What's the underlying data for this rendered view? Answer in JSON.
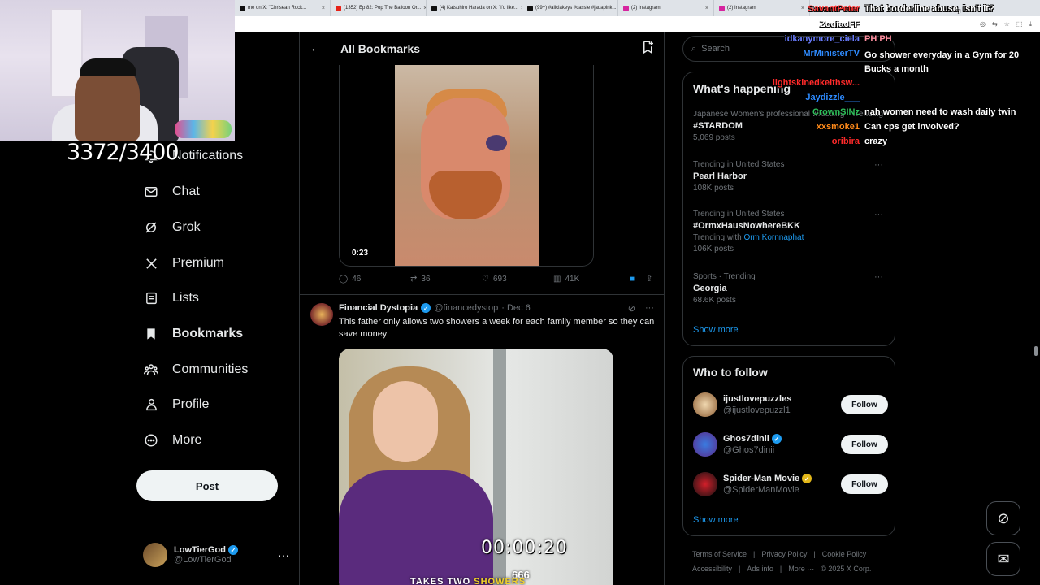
{
  "browser": {
    "tabs": [
      {
        "label": "me on X: \"Chrisean Rock...",
        "color": "#111111"
      },
      {
        "label": "(1352) Ep 82: Pop The Balloon Or...",
        "color": "#e62117"
      },
      {
        "label": "(4) Katsuhiro Harada on X: \"I'd like...",
        "color": "#111111"
      },
      {
        "label": "(99+) #aliciakeys #cassie #jadapink...",
        "color": "#111111"
      },
      {
        "label": "(2) Instagram",
        "color": "#d6249f"
      },
      {
        "label": "(2) Instagram",
        "color": "#d6249f"
      }
    ]
  },
  "overlay": {
    "counter": "3372/3400",
    "timer": "00:00:20",
    "number": "666",
    "caption_white": "TAKES TWO",
    "caption_yellow": "SHOWERS"
  },
  "nav": {
    "notifications": "Notifications",
    "chat": "Chat",
    "grok": "Grok",
    "premium": "Premium",
    "lists": "Lists",
    "bookmarks": "Bookmarks",
    "communities": "Communities",
    "profile": "Profile",
    "more": "More",
    "post": "Post"
  },
  "account": {
    "name": "LowTierGod",
    "handle": "@LowTierGod"
  },
  "center": {
    "title": "All Bookmarks",
    "tweet1": {
      "duration": "0:23",
      "replies": "46",
      "reposts": "36",
      "likes": "693",
      "views": "41K"
    },
    "tweet2": {
      "name": "Financial Dystopia",
      "handle": "@financedystop",
      "date": "· Dec 6",
      "text": "This father only allows two showers a week for each family member so they can save money"
    }
  },
  "right": {
    "search_placeholder": "Search",
    "happening_title": "What's happening",
    "trends": [
      {
        "meta": "Japanese Women's professional wrestling · Trending",
        "title": "#STARDOM",
        "count": "5,069 posts"
      },
      {
        "meta": "Trending in United States",
        "title": "Pearl Harbor",
        "count": "108K posts"
      },
      {
        "meta": "Trending in United States",
        "title": "#OrmxHausNowhereBKK",
        "with_label": "Trending with",
        "with_link": "Orm Kornnaphat",
        "count": "106K posts"
      },
      {
        "meta": "Sports · Trending",
        "title": "Georgia",
        "count": "68.6K posts"
      }
    ],
    "show_more": "Show more",
    "who_title": "Who to follow",
    "who": [
      {
        "name": "ijustlovepuzzles",
        "handle": "@ijustlovepuzzl1",
        "follow": "Follow"
      },
      {
        "name": "Ghos7dinii",
        "handle": "@Ghos7dinii",
        "follow": "Follow"
      },
      {
        "name": "Spider-Man Movie",
        "handle": "@SpiderManMovie",
        "follow": "Follow"
      }
    ],
    "show_more2": "Show more",
    "footer": {
      "terms": "Terms of Service",
      "privacy": "Privacy Policy",
      "cookie": "Cookie Policy",
      "access": "Accessibility",
      "ads": "Ads info",
      "more": "More ···",
      "copy": "© 2025 X Corp."
    }
  },
  "chat": [
    {
      "user": "SavantPeter",
      "user_color": "#ff3b3b",
      "msg": "That borderline abuse, isn't it?"
    },
    {
      "user": "ZodiacFF",
      "user_color": "#ffffff",
      "msg": ""
    },
    {
      "user": "idkanymore_ciela",
      "user_color": "#6a7dff",
      "msg": "PH PH"
    },
    {
      "user": "MrMinisterTV",
      "user_color": "#2e8bff",
      "msg": "Go shower everyday in a Gym for 20 Bucks a month"
    },
    {
      "user": "lightskinedkeithsw...",
      "user_color": "#ff2a2a",
      "msg": ""
    },
    {
      "user": "Jaydizzle___",
      "user_color": "#2e8bff",
      "msg": ""
    },
    {
      "user": "CrownSINz",
      "user_color": "#2fbf5a",
      "msg": "nah women need to wash daily twin"
    },
    {
      "user": "xxsmoke1",
      "user_color": "#ff8a1a",
      "msg": "Can cps get involved?"
    },
    {
      "user": "oribira",
      "user_color": "#ff2a2a",
      "msg": "crazy"
    }
  ]
}
